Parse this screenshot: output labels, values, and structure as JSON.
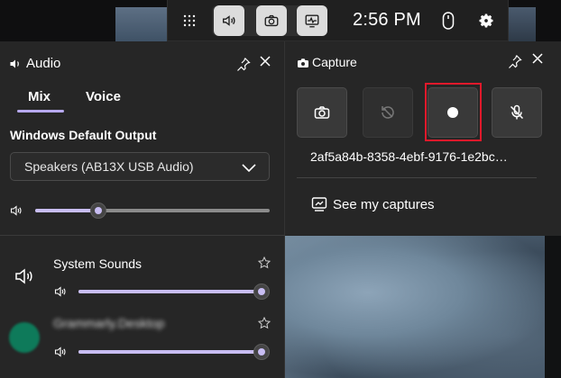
{
  "topbar": {
    "time": "2:56 PM",
    "widgets": [
      {
        "name": "audio",
        "icon": "speaker-icon",
        "active": true
      },
      {
        "name": "capture",
        "icon": "camera-icon",
        "active": true
      },
      {
        "name": "performance",
        "icon": "performance-icon",
        "active": true
      }
    ]
  },
  "audio": {
    "title": "Audio",
    "tabs": [
      {
        "label": "Mix",
        "selected": true
      },
      {
        "label": "Voice",
        "selected": false
      }
    ],
    "output_section": "Windows Default Output",
    "output_device": "Speakers (AB13X USB Audio)",
    "master_volume": 0.27,
    "apps": [
      {
        "name": "System Sounds",
        "volume": 1.0
      },
      {
        "name": "Grammarly.Desktop",
        "volume": 1.0
      }
    ]
  },
  "capture": {
    "title": "Capture",
    "buttons": [
      "screenshot",
      "record-last",
      "start-recording",
      "microphone-off"
    ],
    "filename": "2af5a84b-8358-4ebf-9176-1e2bc…",
    "see_captures": "See my captures"
  },
  "colors": {
    "accent": "#c8bdf3",
    "panel_bg": "#262626",
    "highlight": "#e0192b"
  }
}
